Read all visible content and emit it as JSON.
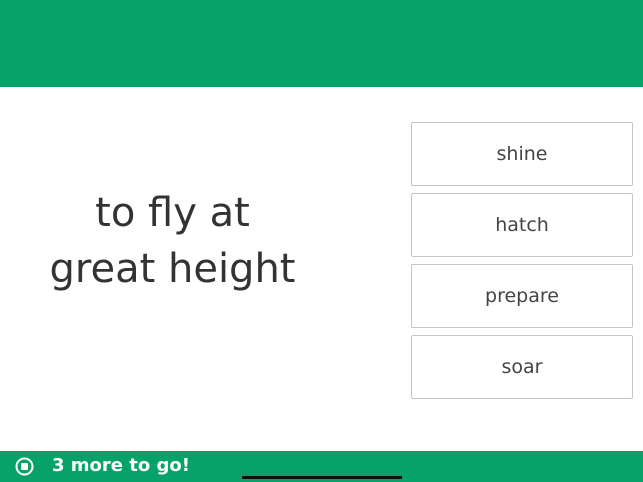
{
  "header": {
    "color": "#07a26a"
  },
  "prompt": {
    "line1": "to fly at",
    "line2": "great height"
  },
  "choices": [
    {
      "label": "shine"
    },
    {
      "label": "hatch"
    },
    {
      "label": "prepare"
    },
    {
      "label": "soar"
    }
  ],
  "footer": {
    "stop_icon": "stop-circle-icon",
    "progress_text": "3 more to go!",
    "color": "#07a26a"
  }
}
